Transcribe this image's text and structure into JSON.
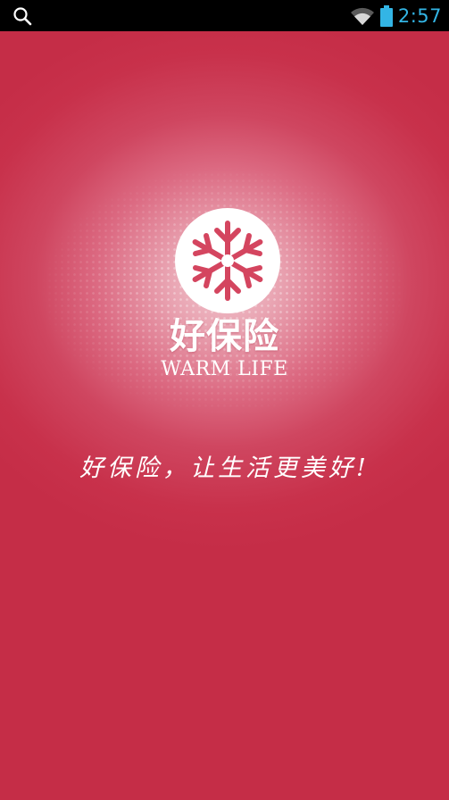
{
  "status_bar": {
    "time": "2:57",
    "icons": [
      "search-icon",
      "wifi-icon",
      "battery-icon"
    ],
    "accent_color": "#33b5e5"
  },
  "splash": {
    "logo_icon": "snowflake-logo-icon",
    "brand_name_cn": "好保险",
    "brand_name_en": "WARM LIFE",
    "slogan": "好保险，让生活更美好!",
    "background_color": "#c8314b"
  }
}
